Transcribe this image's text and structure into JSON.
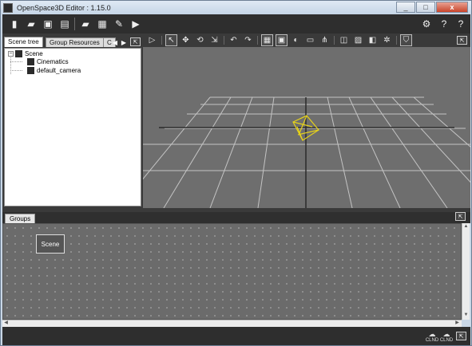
{
  "window": {
    "title": "OpenSpace3D Editor : 1.15.0",
    "minimize_label": "_",
    "maximize_label": "□",
    "close_label": "x"
  },
  "toolbar": {
    "buttons": [
      {
        "icon": "new-file-icon",
        "glyph": "▮"
      },
      {
        "icon": "open-folder-icon",
        "glyph": "▰"
      },
      {
        "icon": "save-icon",
        "glyph": "▣"
      },
      {
        "icon": "save-as-icon",
        "glyph": "▤"
      },
      {
        "icon": "add-resource-icon",
        "glyph": "▰"
      },
      {
        "icon": "calculator-icon",
        "glyph": "▦"
      },
      {
        "icon": "tools-icon",
        "glyph": "✎"
      },
      {
        "icon": "run-player-icon",
        "glyph": "▶"
      }
    ],
    "right_buttons": [
      {
        "icon": "settings-icon",
        "glyph": "⚙"
      },
      {
        "icon": "help-icon",
        "glyph": "?"
      },
      {
        "icon": "user-help-icon",
        "glyph": "?"
      }
    ]
  },
  "scene_tabs": {
    "tabs": [
      "Scene tree",
      "Group Resources",
      "C"
    ],
    "prev_arrow": "◀",
    "next_arrow": "▶"
  },
  "scene_tree": {
    "root": {
      "label": "Scene",
      "expander": "⊟"
    },
    "children": [
      {
        "label": "Cinematics"
      },
      {
        "label": "default_camera"
      }
    ]
  },
  "viewport_toolbar": {
    "buttons": [
      {
        "icon": "play-icon",
        "glyph": "▷"
      },
      {
        "icon": "select-arrow-icon",
        "glyph": "↖"
      },
      {
        "icon": "move-icon",
        "glyph": "✥"
      },
      {
        "icon": "rotate-icon",
        "glyph": "⟲"
      },
      {
        "icon": "scale-icon",
        "glyph": "⇲"
      },
      {
        "icon": "undo-icon",
        "glyph": "↶"
      },
      {
        "icon": "redo-icon",
        "glyph": "↷"
      },
      {
        "icon": "grid-view-icon",
        "glyph": "▦"
      },
      {
        "icon": "wireframe-icon",
        "glyph": "▣"
      },
      {
        "icon": "sphere-icon",
        "glyph": "◐"
      },
      {
        "icon": "camera-view-icon",
        "glyph": "▭"
      },
      {
        "icon": "snap-icon",
        "glyph": "⋔"
      },
      {
        "icon": "cube-icon",
        "glyph": "◫"
      },
      {
        "icon": "texture-icon",
        "glyph": "▨"
      },
      {
        "icon": "shading-icon",
        "glyph": "◧"
      },
      {
        "icon": "physics-icon",
        "glyph": "✲"
      },
      {
        "icon": "shield-icon",
        "glyph": "⛉"
      }
    ]
  },
  "groups_panel": {
    "tab_label": "Groups",
    "nodes": [
      {
        "label": "Scene"
      }
    ]
  },
  "status_bar": {
    "buttons": [
      {
        "icon": "cloud-save-icon",
        "label": "CLND"
      },
      {
        "icon": "cloud-network-icon",
        "label": "CLND"
      }
    ]
  },
  "colors": {
    "toolbar_bg": "#2e2e2e",
    "viewport_bg": "#6e6e6e",
    "grid_line": "#b8b8b8",
    "camera_wireframe": "#e6d21a"
  }
}
